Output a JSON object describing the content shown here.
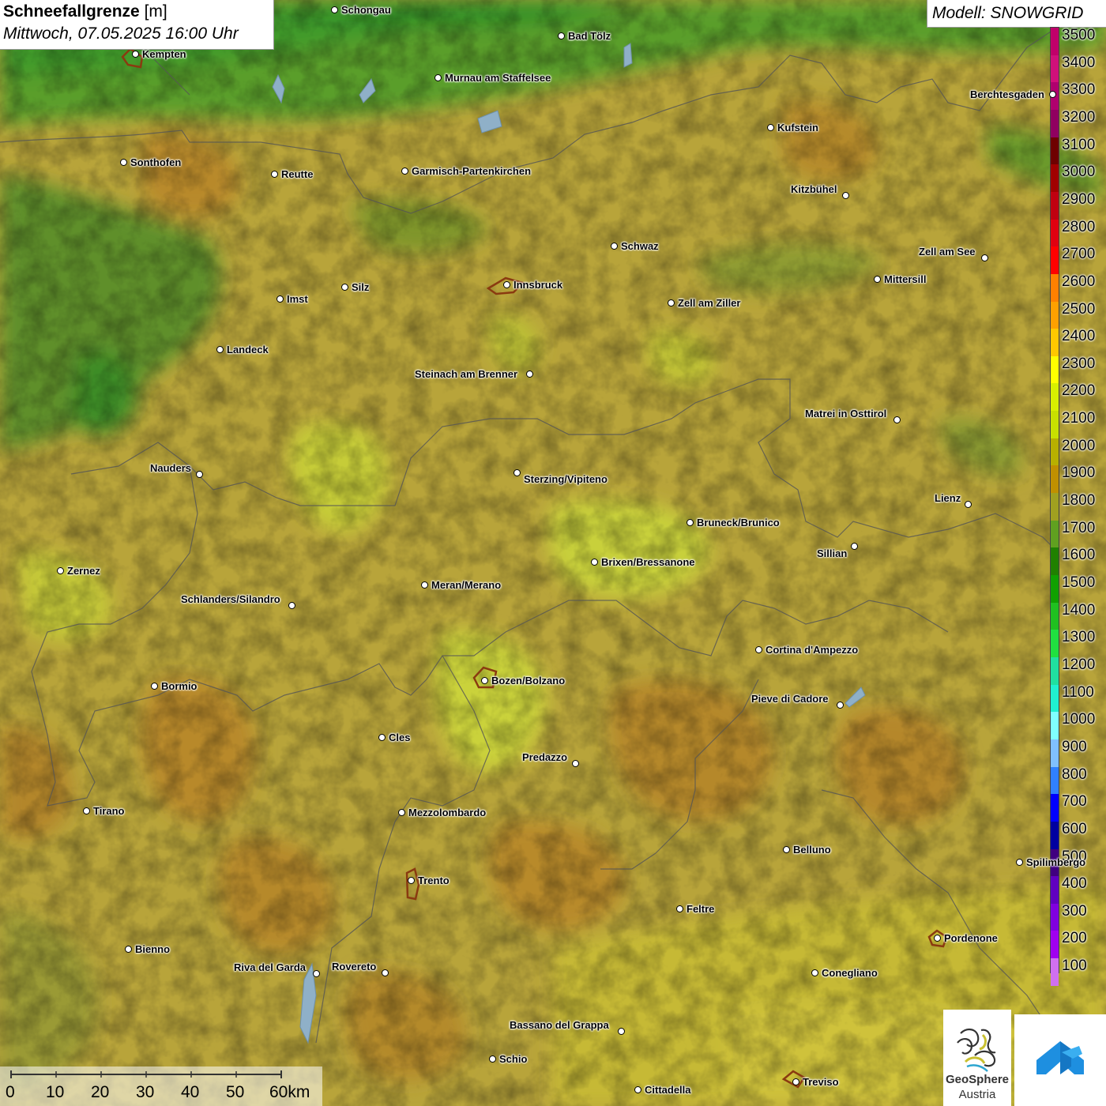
{
  "header": {
    "title_bold": "Schneefallgrenze",
    "title_unit": "[m]",
    "subtitle": "Mittwoch, 07.05.2025 16:00 Uhr",
    "model": "Modell: SNOWGRID"
  },
  "legend": {
    "values": [
      "3500",
      "3400",
      "3300",
      "3200",
      "3100",
      "3000",
      "2900",
      "2800",
      "2700",
      "2600",
      "2500",
      "2400",
      "2300",
      "2200",
      "2100",
      "2000",
      "1900",
      "1800",
      "1700",
      "1600",
      "1500",
      "1400",
      "1300",
      "1200",
      "1100",
      "1000",
      "900",
      "800",
      "700",
      "600",
      "500",
      "400",
      "300",
      "200",
      "100"
    ],
    "colors": [
      "#c0006a",
      "#d0107a",
      "#b0006e",
      "#900060",
      "#6e0000",
      "#a00000",
      "#c00010",
      "#e00010",
      "#ff0000",
      "#ff8000",
      "#ffa000",
      "#ffc800",
      "#ffff00",
      "#d8f000",
      "#c8e000",
      "#b8b000",
      "#c09000",
      "#a0a020",
      "#60a020",
      "#208000",
      "#10a000",
      "#20c020",
      "#20e040",
      "#20e0a0",
      "#20f0d0",
      "#80ffff",
      "#80c0ff",
      "#3080ff",
      "#0000ff",
      "#0000a0",
      "#400080",
      "#6000c0",
      "#8000e0",
      "#a000f0",
      "#d070f0"
    ]
  },
  "cities": [
    {
      "name": "Schongau"
    },
    {
      "name": "Bad Tölz"
    },
    {
      "name": "Kempten"
    },
    {
      "name": "Murnau am Staffelsee"
    },
    {
      "name": "Berchtesgaden"
    },
    {
      "name": "Kufstein"
    },
    {
      "name": "Sonthofen"
    },
    {
      "name": "Reutte"
    },
    {
      "name": "Garmisch-Partenkirchen"
    },
    {
      "name": "Kitzbühel"
    },
    {
      "name": "Schwaz"
    },
    {
      "name": "Zell am See"
    },
    {
      "name": "Imst"
    },
    {
      "name": "Silz"
    },
    {
      "name": "Innsbruck"
    },
    {
      "name": "Mittersill"
    },
    {
      "name": "Zell am Ziller"
    },
    {
      "name": "Landeck"
    },
    {
      "name": "Steinach am Brenner"
    },
    {
      "name": "Matrei in Osttirol"
    },
    {
      "name": "Nauders"
    },
    {
      "name": "Sterzing/Vipiteno"
    },
    {
      "name": "Lienz"
    },
    {
      "name": "Bruneck/Brunico"
    },
    {
      "name": "Sillian"
    },
    {
      "name": "Zernez"
    },
    {
      "name": "Brixen/Bressanone"
    },
    {
      "name": "Meran/Merano"
    },
    {
      "name": "Schlanders/Silandro"
    },
    {
      "name": "Cortina d'Ampezzo"
    },
    {
      "name": "Bozen/Bolzano"
    },
    {
      "name": "Bormio"
    },
    {
      "name": "Pieve di Cadore"
    },
    {
      "name": "Cles"
    },
    {
      "name": "Predazzo"
    },
    {
      "name": "Tirano"
    },
    {
      "name": "Mezzolombardo"
    },
    {
      "name": "Belluno"
    },
    {
      "name": "Spilimbergo"
    },
    {
      "name": "Trento"
    },
    {
      "name": "Feltre"
    },
    {
      "name": "Pordenone"
    },
    {
      "name": "Bienno"
    },
    {
      "name": "Riva del Garda"
    },
    {
      "name": "Rovereto"
    },
    {
      "name": "Conegliano"
    },
    {
      "name": "Bassano del Grappa"
    },
    {
      "name": "Schio"
    },
    {
      "name": "Treviso"
    },
    {
      "name": "Cittadella"
    }
  ],
  "scale": {
    "ticks": [
      "0",
      "10",
      "20",
      "30",
      "40",
      "50",
      "60km"
    ]
  },
  "logos": {
    "geosphere_line1": "GeoSphere",
    "geosphere_line2": "Austria"
  }
}
